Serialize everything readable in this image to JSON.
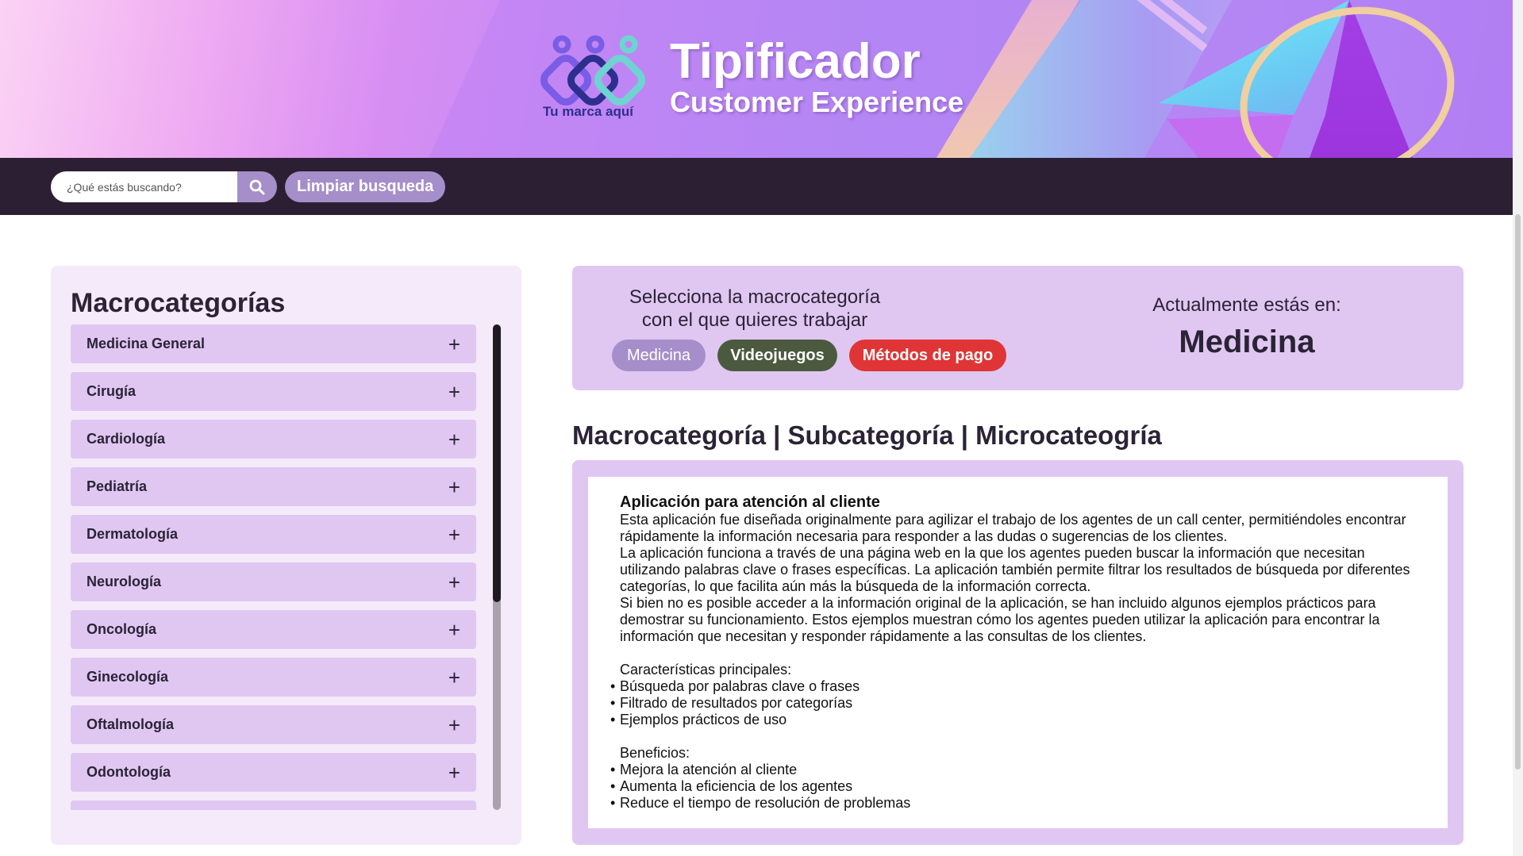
{
  "banner": {
    "logo_text": "Tu marca aquí",
    "title": "Tipificador",
    "subtitle": "Customer Experience"
  },
  "search": {
    "placeholder": "¿Qué estás buscando?",
    "value": "",
    "clear_label": "Limpiar busqueda"
  },
  "sidebar": {
    "title": "Macrocategorías",
    "items": [
      {
        "label": "Medicina General"
      },
      {
        "label": "Cirugía"
      },
      {
        "label": "Cardiología"
      },
      {
        "label": "Pediatría"
      },
      {
        "label": "Dermatología"
      },
      {
        "label": "Neurología"
      },
      {
        "label": "Oncología"
      },
      {
        "label": "Ginecología"
      },
      {
        "label": "Oftalmología"
      },
      {
        "label": "Odontología"
      }
    ],
    "expand_symbol": "+"
  },
  "selector": {
    "prompt": "Selecciona la macrocategoría con el que quieres trabajar",
    "options": [
      {
        "label": "Medicina",
        "color": "#a58ec9"
      },
      {
        "label": "Videojuegos",
        "color": "#4b5a3e"
      },
      {
        "label": "Métodos de pago",
        "color": "#e03536"
      }
    ],
    "current_label": "Actualmente estás en:",
    "current_value": "Medicina"
  },
  "breadcrumb": "Macrocategoría | Subcategoría | Microcateogría",
  "content": {
    "heading": "Aplicación para atención al cliente",
    "paragraphs": [
      "Esta aplicación fue diseñada originalmente para agilizar el trabajo de los agentes de un call center, permitiéndoles encontrar rápidamente la información necesaria para responder a las dudas o sugerencias de los clientes.",
      "La aplicación funciona a través de una página web en la que los agentes pueden buscar la información que necesitan utilizando palabras clave o frases específicas. La aplicación también permite filtrar los resultados de búsqueda por diferentes categorías, lo que facilita aún más la búsqueda de la información correcta.",
      "Si bien no es posible acceder a la información original de la aplicación, se han incluido algunos ejemplos prácticos para demostrar su funcionamiento. Estos ejemplos muestran cómo los agentes pueden utilizar la aplicación para encontrar la información que necesitan y responder rápidamente a las consultas de los clientes."
    ],
    "features_title": "Características principales:",
    "features": [
      "Búsqueda por palabras clave o frases",
      "Filtrado de resultados por categorías",
      "Ejemplos prácticos de uso"
    ],
    "benefits_title": "Beneficios:",
    "benefits": [
      "Mejora la atención al cliente",
      "Aumenta la eficiencia de los agentes",
      "Reduce el tiempo de resolución de problemas"
    ]
  },
  "icons": {
    "search": "search-icon",
    "logo": "brand-logo-icon"
  }
}
